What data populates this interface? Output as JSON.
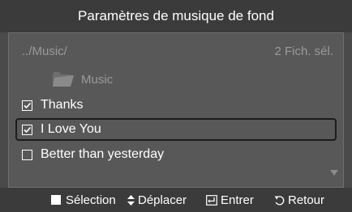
{
  "title": "Paramètres de musique de fond",
  "header": {
    "path": "../Music/",
    "selected_count": "2 Fich. sél."
  },
  "folder": {
    "icon": "folder-icon",
    "label": "Music"
  },
  "items": [
    {
      "label": "Thanks",
      "checked": true,
      "focused": false
    },
    {
      "label": "I Love You",
      "checked": true,
      "focused": true
    },
    {
      "label": "Better than yesterday",
      "checked": false,
      "focused": false
    }
  ],
  "footer": {
    "select_label": "Sélection",
    "move_label": "Déplacer",
    "enter_label": "Entrer",
    "return_label": "Retour"
  },
  "colors": {
    "background": "#4a4a4a",
    "panel": "#585858",
    "bar": "#3b3b3b",
    "muted_text": "#9a9a9a"
  }
}
